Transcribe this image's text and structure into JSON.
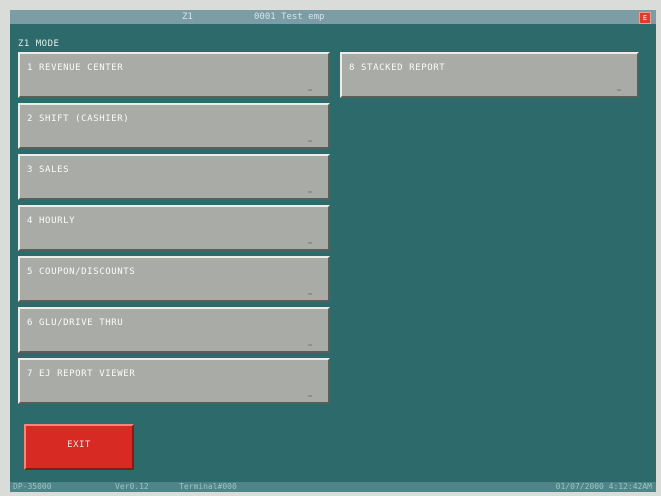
{
  "titlebar": {
    "terminal": "Z1",
    "clerk": "0001 Test emp",
    "close_icon_label": "E"
  },
  "mode_label": "Z1 MODE",
  "menu": [
    {
      "label": "1 REVENUE CENTER"
    },
    {
      "label": "2 SHIFT (CASHIER)"
    },
    {
      "label": "3 SALES"
    },
    {
      "label": "4 HOURLY"
    },
    {
      "label": "5 COUPON/DISCOUNTS"
    },
    {
      "label": "6 GLU/DRIVE THRU"
    },
    {
      "label": "7 EJ REPORT VIEWER"
    },
    {
      "label": "8 STACKED REPORT"
    }
  ],
  "exit_label": "EXIT",
  "statusbar": {
    "model": "DP-35000",
    "version": "Ver0.12",
    "terminal": "Terminal#000",
    "datetime": "01/07/2000 4:12:42AM"
  },
  "colors": {
    "background": "#2c6a6b",
    "button_face": "#a9aba7",
    "exit_button": "#d72a22",
    "titlebar": "#7c9da6",
    "close_button": "#e23b2c"
  }
}
